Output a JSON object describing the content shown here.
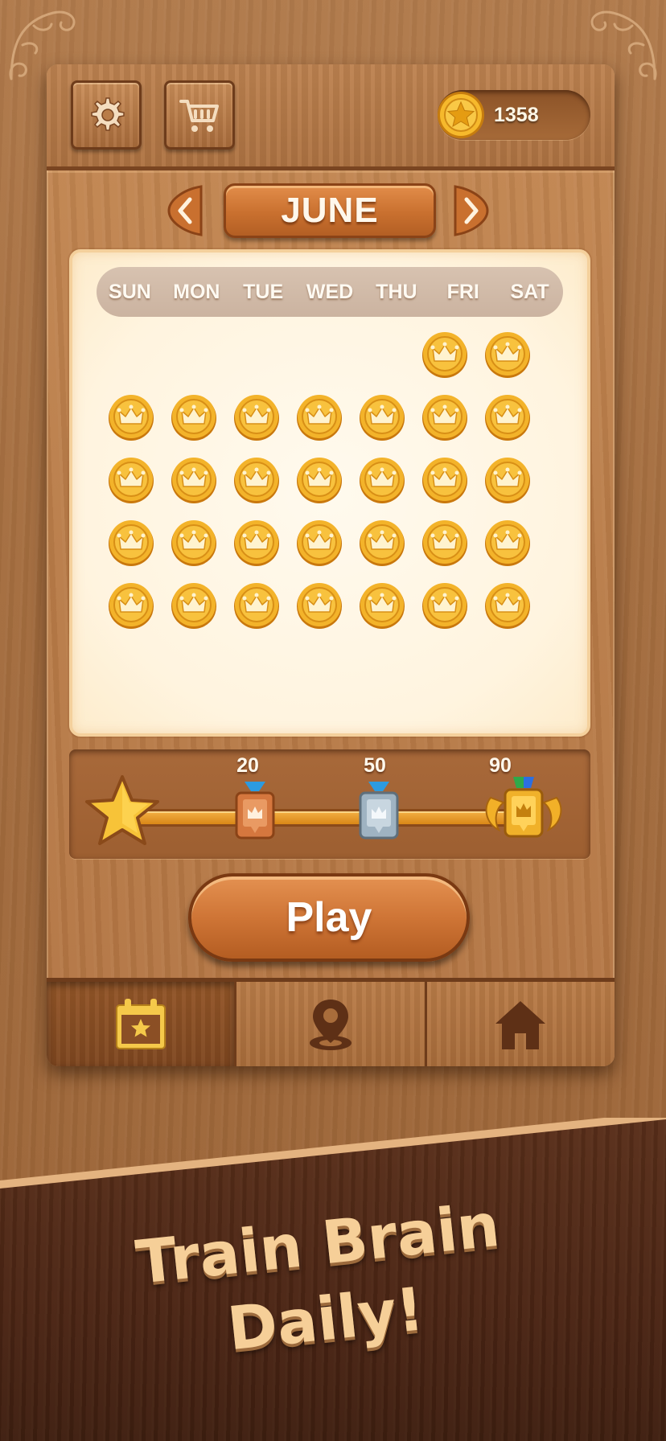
{
  "colors": {
    "wood": "#b97c48",
    "dark_wood": "#4b2514",
    "cream": "#fff4df",
    "gold": "#f3b32a",
    "accent_orange": "#cf7536"
  },
  "header": {
    "settings_icon": "gear-icon",
    "shop_icon": "cart-icon",
    "coin_icon": "star-coin-icon",
    "coins": "1358"
  },
  "month_selector": {
    "month": "JUNE",
    "prev_icon": "chevron-left-icon",
    "next_icon": "chevron-right-icon"
  },
  "calendar": {
    "weekdays": [
      "SUN",
      "MON",
      "TUE",
      "WED",
      "THU",
      "FRI",
      "SAT"
    ],
    "first_weekday_index": 5,
    "days_in_month": 30,
    "completed_days": 30,
    "day_icon": "crown-coin-icon"
  },
  "progress": {
    "start_icon": "star-icon",
    "milestones": [
      {
        "value": "20",
        "icon": "bronze-medal-icon"
      },
      {
        "value": "50",
        "icon": "silver-medal-icon"
      },
      {
        "value": "90",
        "icon": "gold-trophy-icon"
      }
    ]
  },
  "play_button": {
    "label": "Play"
  },
  "nav": {
    "items": [
      {
        "icon": "calendar-star-icon",
        "active": true
      },
      {
        "icon": "map-pin-icon",
        "active": false
      },
      {
        "icon": "home-icon",
        "active": false
      }
    ]
  },
  "banner": {
    "line1": "Train Brain",
    "line2": "Daily!"
  }
}
